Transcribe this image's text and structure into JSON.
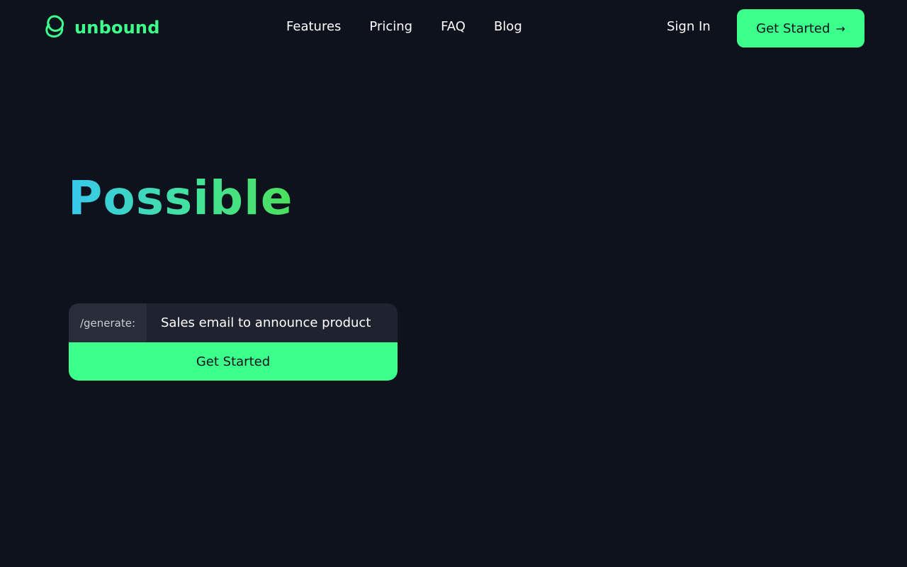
{
  "brand": {
    "name": "unbound",
    "accent": "#3dff8b",
    "icon": "interlocking-rings-logo-icon"
  },
  "nav": {
    "links": [
      "Features",
      "Pricing",
      "FAQ",
      "Blog"
    ],
    "sign_in": "Sign In",
    "cta": {
      "label": "Get Started",
      "icon": "arrow-right-icon",
      "arrow": "→"
    }
  },
  "hero": {
    "title": "Possible",
    "gradient": [
      "#38c7ee",
      "#4be05a"
    ]
  },
  "generator": {
    "prefix": "/generate:",
    "value": "Sales email to announce product",
    "button": "Get Started"
  },
  "colors": {
    "background": "#0d121c",
    "input_bg": "#1f2330",
    "prefix_bg": "#292d3a"
  }
}
